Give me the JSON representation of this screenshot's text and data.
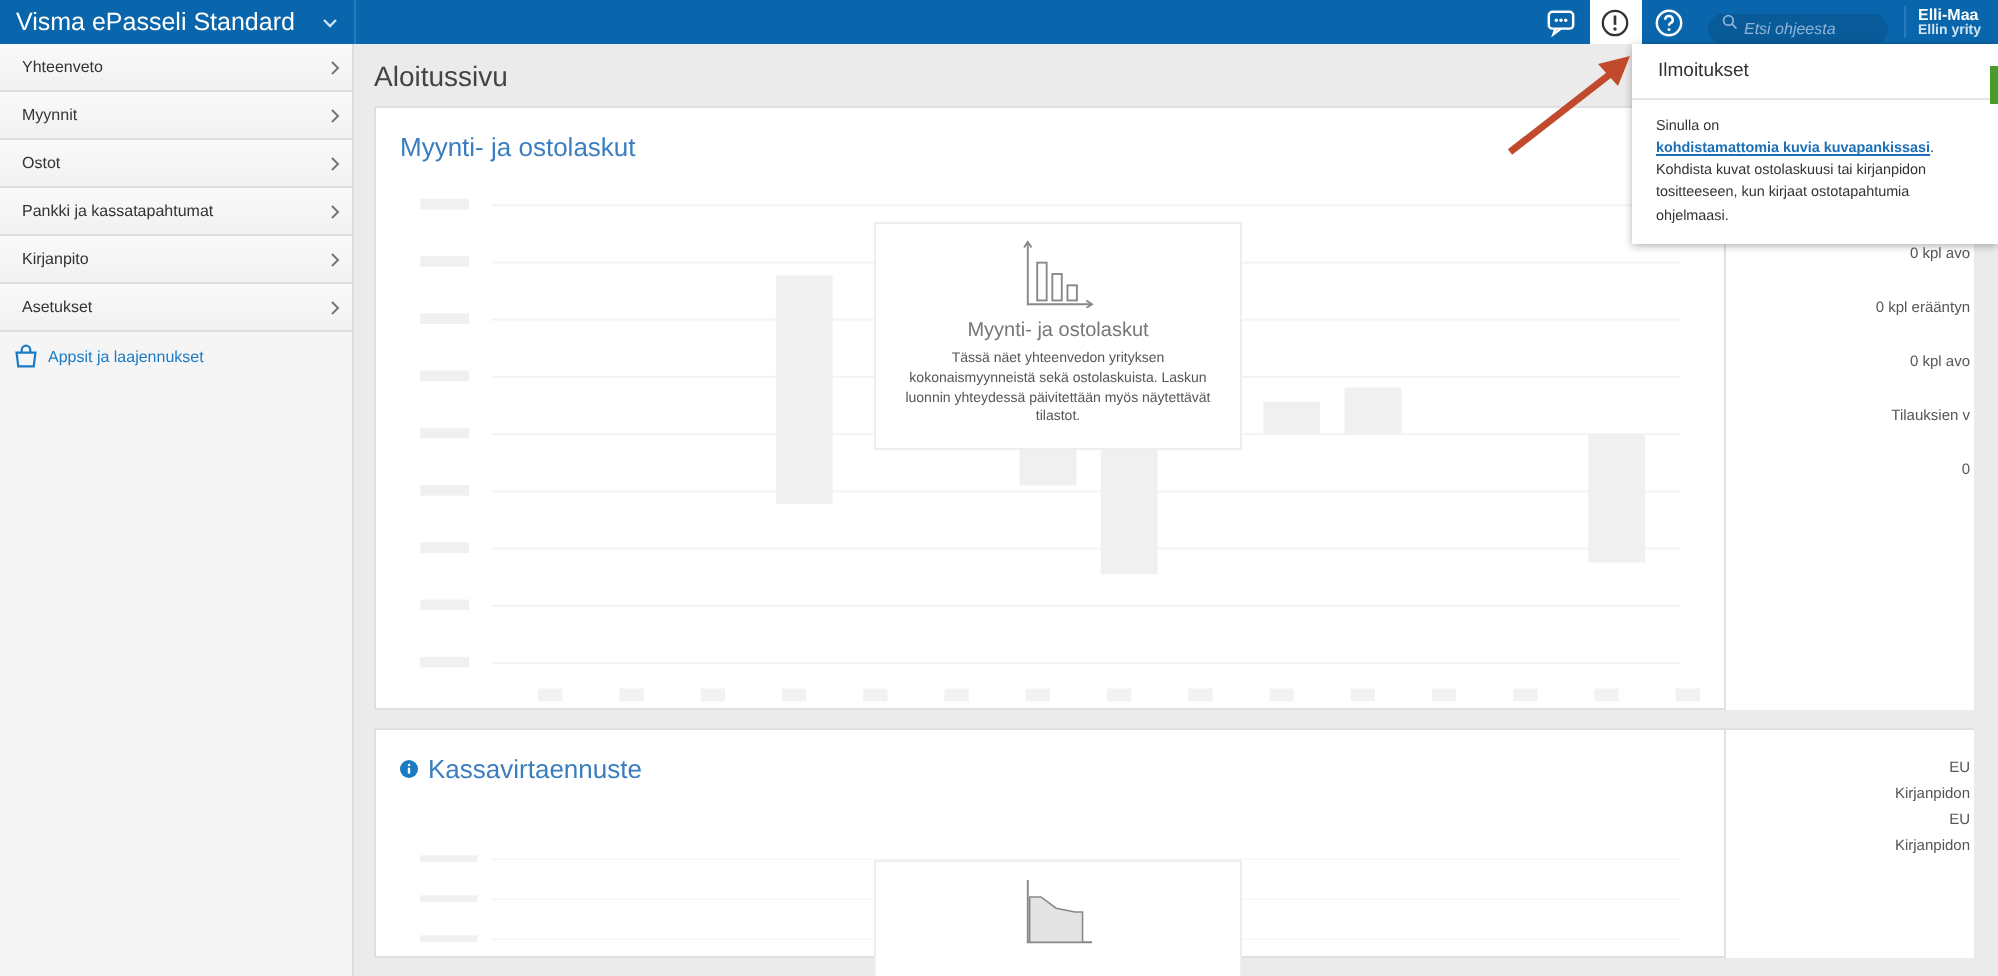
{
  "app": {
    "title": "Visma ePasseli Standard"
  },
  "header": {
    "search": {
      "placeholder": "Etsi ohjeesta"
    },
    "user": {
      "name": "Elli-Maa",
      "company": "Ellin yrity"
    }
  },
  "sidebar": {
    "items": [
      {
        "label": "Yhteenveto"
      },
      {
        "label": "Myynnit"
      },
      {
        "label": "Ostot"
      },
      {
        "label": "Pankki ja kassatapahtumat"
      },
      {
        "label": "Kirjanpito"
      },
      {
        "label": "Asetukset"
      }
    ],
    "extra": "Appsit ja laajennukset"
  },
  "page": {
    "title": "Aloitussivu"
  },
  "cards": [
    {
      "kind": "bar",
      "title": "Myynti- ja ostolaskut",
      "info": false,
      "empty_title": "Myynti- ja ostolaskut",
      "empty_text": "Tässä näet yhteenvedon yrityksen kokonaismyynneistä sekä ostolaskuista. Laskun luonnin yhteydessä päivitettään myös näytettävät tilastot.",
      "side": [
        "0 kpl avo",
        "0 kpl erääntyn",
        "0 kpl avo",
        "Tilauksien v",
        "0"
      ]
    },
    {
      "kind": "area",
      "title": "Kassavirtaennuste",
      "info": true,
      "side": [
        "EU",
        "Kirjanpidon",
        "EU",
        "Kirjanpidon"
      ]
    }
  ],
  "notifications": {
    "open": true,
    "title": "Ilmoitukset",
    "before": "Sinulla on ",
    "link": "kohdistamattomia kuvia kuvapankissasi",
    "after": ". Kohdista kuvat ostolaskuusi tai kirjanpidon tositteeseen, kun kirjaat ostotapahtumia ohjelmaasi."
  }
}
